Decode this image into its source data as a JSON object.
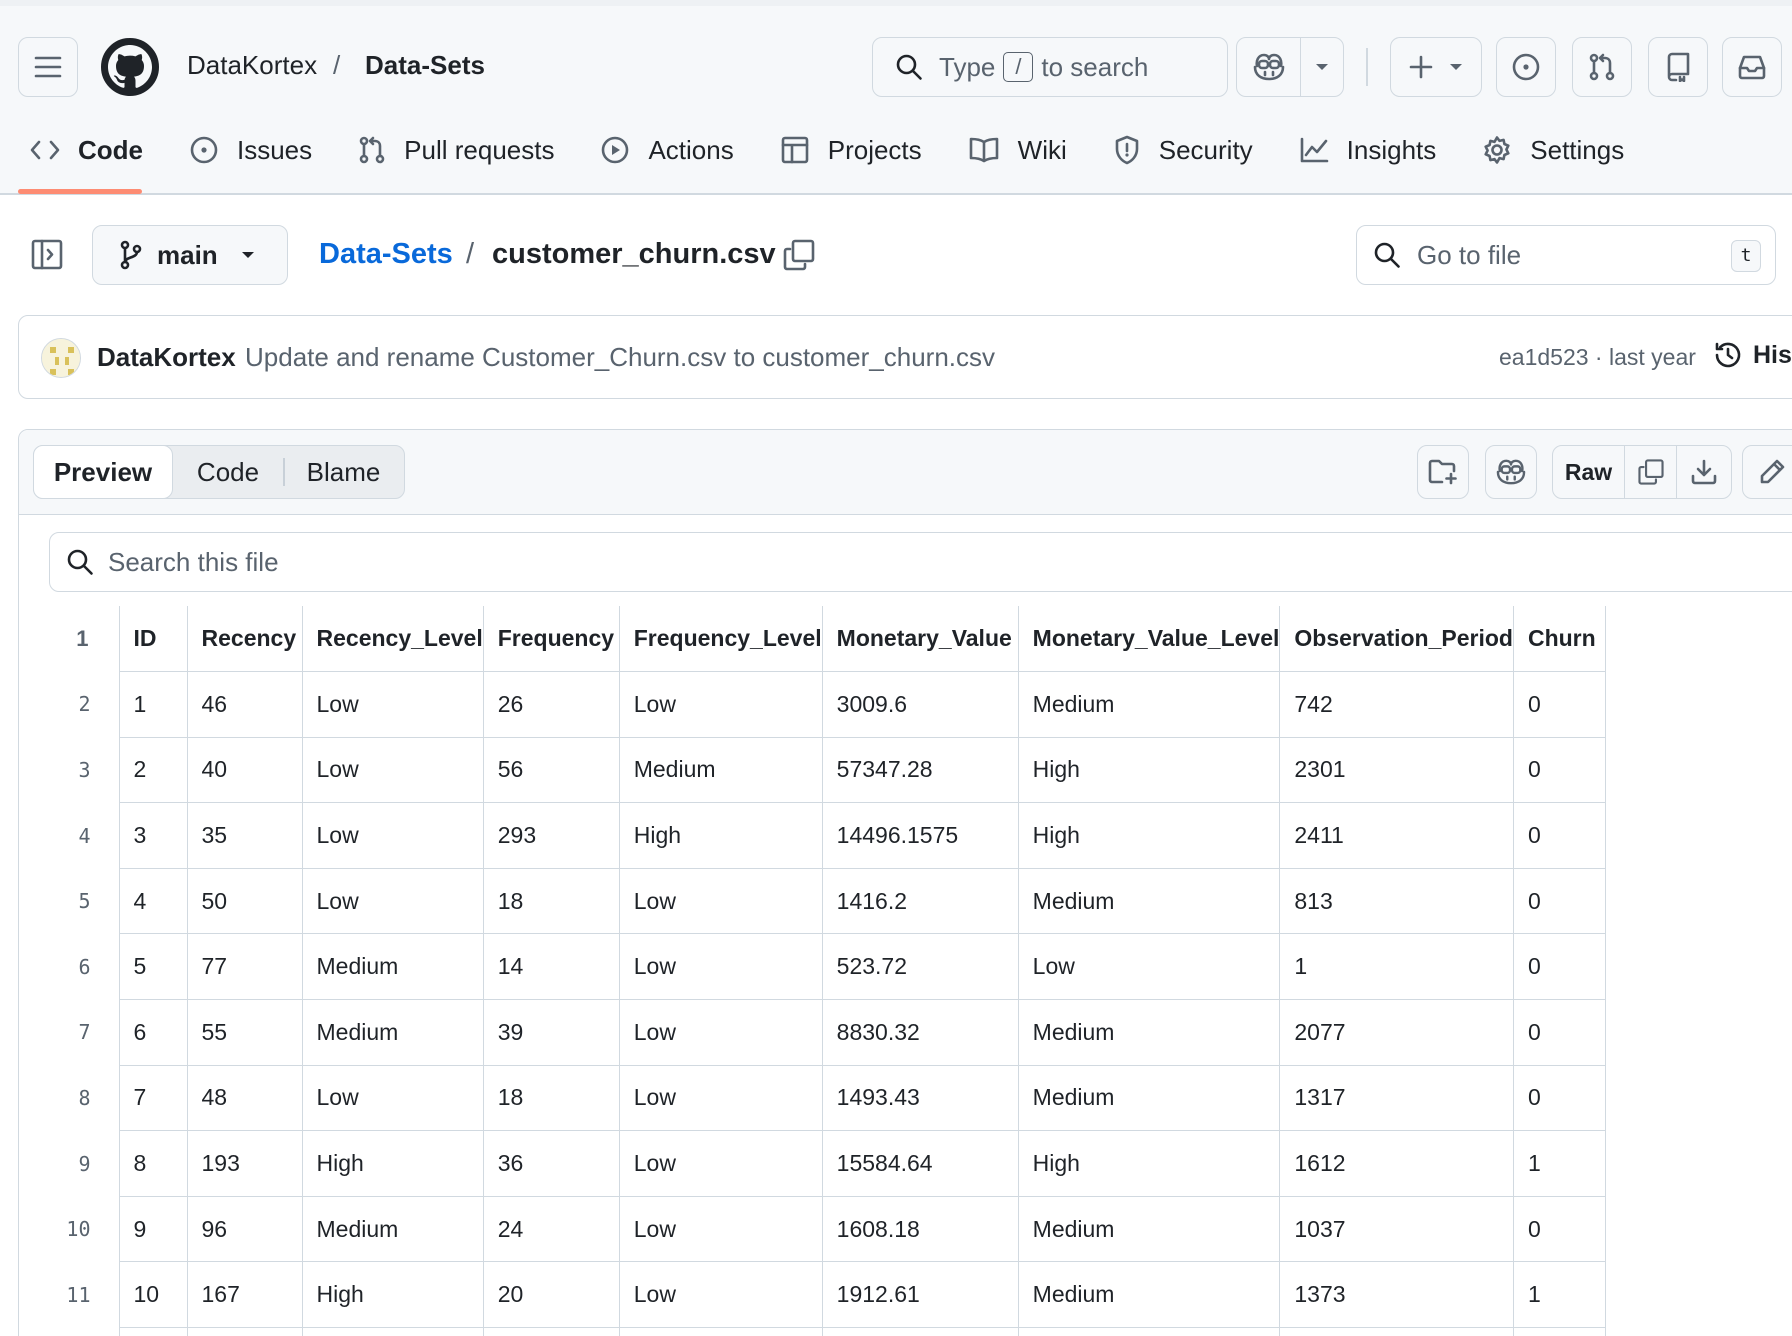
{
  "header": {
    "owner": "DataKortex",
    "separator": "/",
    "repo": "Data-Sets",
    "search": {
      "prefix": "Type",
      "key": "/",
      "suffix": "to search"
    }
  },
  "tabs": [
    {
      "label": "Code",
      "icon": "code-icon"
    },
    {
      "label": "Issues",
      "icon": "issue-opened-icon"
    },
    {
      "label": "Pull requests",
      "icon": "git-pull-request-icon"
    },
    {
      "label": "Actions",
      "icon": "play-icon"
    },
    {
      "label": "Projects",
      "icon": "table-icon"
    },
    {
      "label": "Wiki",
      "icon": "book-icon"
    },
    {
      "label": "Security",
      "icon": "shield-icon"
    },
    {
      "label": "Insights",
      "icon": "graph-icon"
    },
    {
      "label": "Settings",
      "icon": "gear-icon"
    }
  ],
  "file_bar": {
    "branch": "main",
    "breadcrumb_repo": "Data-Sets",
    "breadcrumb_sep": "/",
    "file_name": "customer_churn.csv",
    "goto_placeholder": "Go to file",
    "goto_key": "t"
  },
  "commit": {
    "author": "DataKortex",
    "message": "Update and rename Customer_Churn.csv to customer_churn.csv",
    "meta": "ea1d523 · last year",
    "history_label": "Hist"
  },
  "viewer": {
    "tabs": [
      "Preview",
      "Code",
      "Blame"
    ],
    "raw_label": "Raw",
    "search_placeholder": "Search this file"
  },
  "table": {
    "headers": [
      "ID",
      "Recency",
      "Recency_Level",
      "Frequency",
      "Frequency_Level",
      "Monetary_Value",
      "Monetary_Value_Level",
      "Observation_Period",
      "Churn"
    ],
    "rows": [
      [
        "1",
        "46",
        "Low",
        "26",
        "Low",
        "3009.6",
        "Medium",
        "742",
        "0"
      ],
      [
        "2",
        "40",
        "Low",
        "56",
        "Medium",
        "57347.28",
        "High",
        "2301",
        "0"
      ],
      [
        "3",
        "35",
        "Low",
        "293",
        "High",
        "14496.1575",
        "High",
        "2411",
        "0"
      ],
      [
        "4",
        "50",
        "Low",
        "18",
        "Low",
        "1416.2",
        "Medium",
        "813",
        "0"
      ],
      [
        "5",
        "77",
        "Medium",
        "14",
        "Low",
        "523.72",
        "Low",
        "1",
        "0"
      ],
      [
        "6",
        "55",
        "Medium",
        "39",
        "Low",
        "8830.32",
        "Medium",
        "2077",
        "0"
      ],
      [
        "7",
        "48",
        "Low",
        "18",
        "Low",
        "1493.43",
        "Medium",
        "1317",
        "0"
      ],
      [
        "8",
        "193",
        "High",
        "36",
        "Low",
        "15584.64",
        "High",
        "1612",
        "1"
      ],
      [
        "9",
        "96",
        "Medium",
        "24",
        "Low",
        "1608.18",
        "Medium",
        "1037",
        "0"
      ],
      [
        "10",
        "167",
        "High",
        "20",
        "Low",
        "1912.61",
        "Medium",
        "1373",
        "1"
      ],
      [
        "",
        "",
        "",
        "",
        "",
        "",
        "",
        "",
        ""
      ]
    ]
  }
}
